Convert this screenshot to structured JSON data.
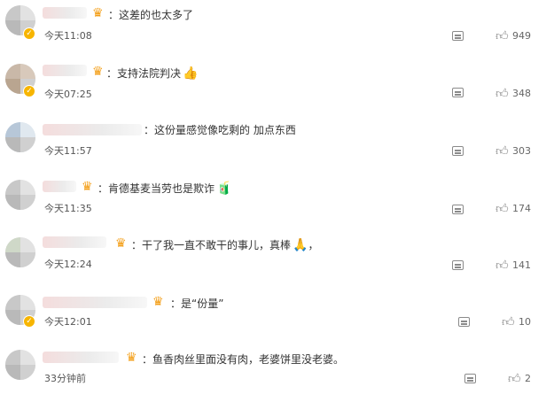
{
  "comments": [
    {
      "content": "：这差的也太多了",
      "emoji": "",
      "time": "今天11:08",
      "likes": "949"
    },
    {
      "content": "：支持法院判决",
      "emoji": "👍",
      "time": "今天07:25",
      "likes": "348"
    },
    {
      "content": "：这份量感觉像吃剩的 加点东西",
      "emoji": "",
      "time": "今天11:57",
      "likes": "303"
    },
    {
      "content": "：肯德基麦当劳也是欺诈",
      "emoji": "🧃",
      "time": "今天11:35",
      "likes": "174"
    },
    {
      "content": "：干了我一直不敢干的事儿，真棒",
      "emoji": "🙏",
      "time": "今天12:24",
      "likes": "141"
    },
    {
      "content": "：是“份量”",
      "emoji": "",
      "time": "今天12:01",
      "likes": "10"
    },
    {
      "content": "：鱼香肉丝里面没有肉，老婆饼里没老婆。",
      "emoji": "",
      "time": "33分钟前",
      "likes": "2"
    }
  ]
}
